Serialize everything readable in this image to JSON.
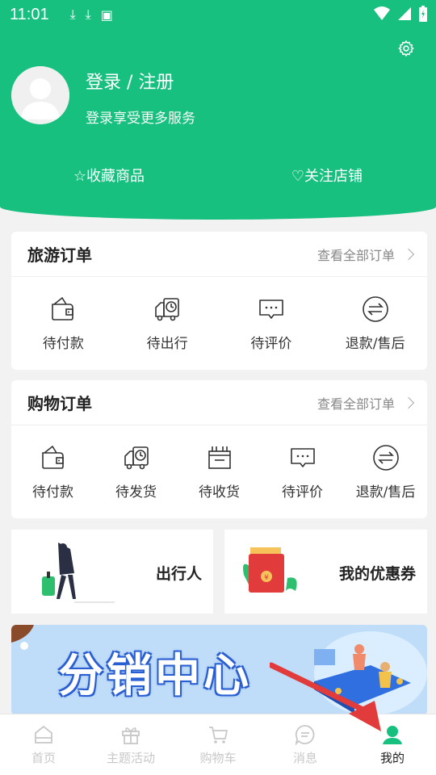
{
  "status_bar": {
    "time": "11:01"
  },
  "header": {
    "login_title": "登录 / 注册",
    "login_subtitle": "登录享受更多服务",
    "favorites_label": "☆收藏商品",
    "follow_label": "♡关注店铺"
  },
  "travel_orders": {
    "title": "旅游订单",
    "view_all": "查看全部订单",
    "items": [
      {
        "label": "待付款",
        "icon": "wallet-icon"
      },
      {
        "label": "待出行",
        "icon": "truck-clock-icon"
      },
      {
        "label": "待评价",
        "icon": "comment-icon"
      },
      {
        "label": "退款/售后",
        "icon": "refund-icon"
      }
    ]
  },
  "shopping_orders": {
    "title": "购物订单",
    "view_all": "查看全部订单",
    "items": [
      {
        "label": "待付款",
        "icon": "wallet-icon"
      },
      {
        "label": "待发货",
        "icon": "truck-clock-icon"
      },
      {
        "label": "待收货",
        "icon": "box-icon"
      },
      {
        "label": "待评价",
        "icon": "comment-icon"
      },
      {
        "label": "退款/售后",
        "icon": "refund-icon"
      }
    ]
  },
  "promos": {
    "traveler": "出行人",
    "coupons": "我的优惠券"
  },
  "banner": {
    "text": "分销中心"
  },
  "bottom_nav": [
    {
      "label": "首页",
      "icon": "home-icon"
    },
    {
      "label": "主题活动",
      "icon": "gift-icon"
    },
    {
      "label": "购物车",
      "icon": "cart-icon"
    },
    {
      "label": "消息",
      "icon": "message-icon"
    },
    {
      "label": "我的",
      "icon": "user-icon"
    }
  ],
  "colors": {
    "brand": "#18c080",
    "active_nav": "#18c080",
    "inactive_nav": "#c8c8c8"
  }
}
